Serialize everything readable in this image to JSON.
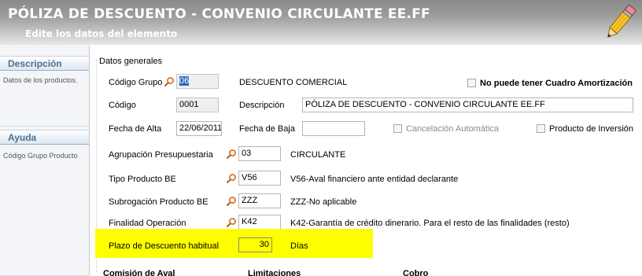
{
  "header": {
    "title": "PÓLIZA DE DESCUENTO - CONVENIO CIRCULANTE EE.FF",
    "subtitle": "Edite los datos del elemento",
    "edit_icon": "pencil-icon"
  },
  "sidebar": {
    "descripcion_heading": "Descripción",
    "descripcion_text": "Datos de los productos.",
    "ayuda_heading": "Ayuda",
    "ayuda_text": "Código Grupo Producto"
  },
  "form": {
    "section_title": "Datos generales",
    "codigo_grupo": {
      "label": "Código Grupo",
      "value": "06",
      "description": "DESCUENTO COMERCIAL"
    },
    "no_cuadro_amortizacion": {
      "label": "No puede tener Cuadro Amortización",
      "checked": false
    },
    "codigo": {
      "label": "Código",
      "value": "0001"
    },
    "descripcion": {
      "label": "Descripción",
      "value": "PÓLIZA DE DESCUENTO - CONVENIO CIRCULANTE EE.FF"
    },
    "fecha_alta": {
      "label": "Fecha de Alta",
      "value": "22/06/2011"
    },
    "fecha_baja": {
      "label": "Fecha de Baja",
      "value": ""
    },
    "cancelacion_automatica": {
      "label": "Cancelación Automática",
      "checked": false
    },
    "producto_inversion": {
      "label": "Producto de Inversión",
      "checked": false
    },
    "agrupacion_presupuestaria": {
      "label": "Agrupación Presupuestaria",
      "value": "03",
      "description": "CIRCULANTE"
    },
    "tipo_producto_be": {
      "label": "Tipo Producto BE",
      "value": "V56",
      "description": "V56-Aval financiero ante entidad declarante"
    },
    "subrogacion_producto_be": {
      "label": "Subrogación Producto BE",
      "value": "ZZZ",
      "description": "ZZZ-No aplicable"
    },
    "finalidad_operacion": {
      "label": "Finalidad Operación",
      "value": "K42",
      "description": "K42-Garantía de crédito dinerario. Para el resto de las finalidades (resto)"
    },
    "plazo_descuento": {
      "label": "Plazo de Descuento habitual",
      "value": "30",
      "unit": "Días"
    }
  },
  "bottom_sections": [
    "Comisión de Aval",
    "Limitaciones",
    "Cobro"
  ],
  "colors": {
    "highlight": "#fefe00",
    "selection": "#3167c6",
    "sidebar_heading": "#4a6f94"
  }
}
